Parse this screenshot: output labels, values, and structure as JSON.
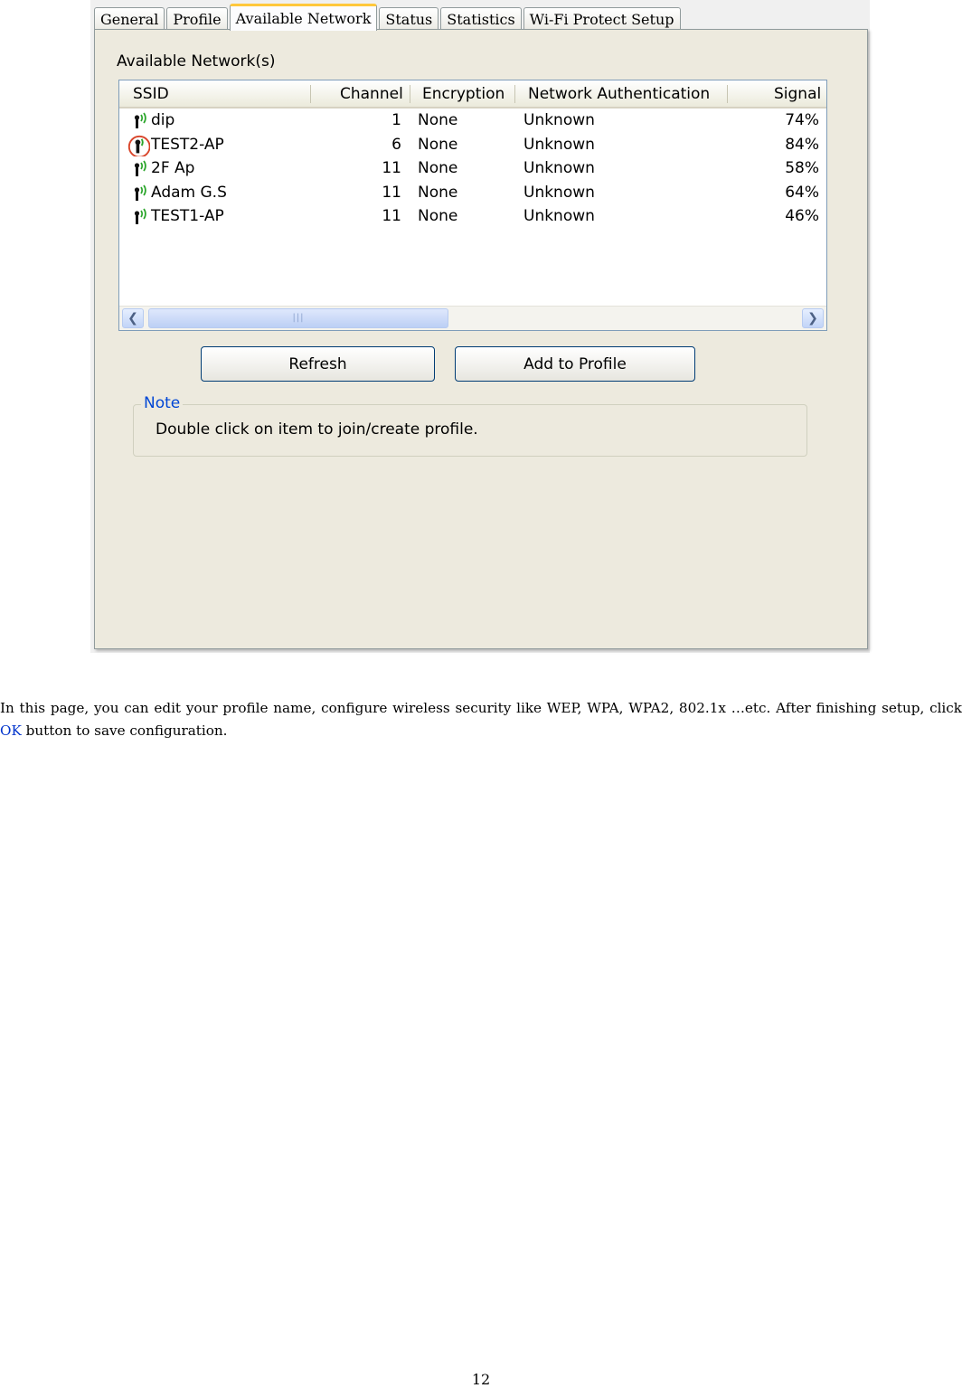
{
  "dialog": {
    "tabs": [
      {
        "label": "General",
        "active": false
      },
      {
        "label": "Profile",
        "active": false
      },
      {
        "label": "Available Network",
        "active": true
      },
      {
        "label": "Status",
        "active": false
      },
      {
        "label": "Statistics",
        "active": false
      },
      {
        "label": "Wi-Fi Protect Setup",
        "active": false
      }
    ],
    "section_title": "Available Network(s)",
    "table": {
      "columns": [
        "SSID",
        "Channel",
        "Encryption",
        "Network Authentication",
        "Signal"
      ],
      "rows": [
        {
          "ssid": "dip",
          "channel": "1",
          "encryption": "None",
          "auth": "Unknown",
          "signal": "74%",
          "connected": false
        },
        {
          "ssid": "TEST2-AP",
          "channel": "6",
          "encryption": "None",
          "auth": "Unknown",
          "signal": "84%",
          "connected": true
        },
        {
          "ssid": "2F Ap",
          "channel": "11",
          "encryption": "None",
          "auth": "Unknown",
          "signal": "58%",
          "connected": false
        },
        {
          "ssid": "Adam G.S",
          "channel": "11",
          "encryption": "None",
          "auth": "Unknown",
          "signal": "64%",
          "connected": false
        },
        {
          "ssid": "TEST1-AP",
          "channel": "11",
          "encryption": "None",
          "auth": "Unknown",
          "signal": "46%",
          "connected": false
        }
      ]
    },
    "buttons": {
      "refresh": "Refresh",
      "add_to_profile": "Add to Profile"
    },
    "note": {
      "label": "Note",
      "text": "Double click on item to join/create profile."
    }
  },
  "document": {
    "paragraph_before": "In this page, you can edit your profile name, configure wireless security like WEP, WPA, WPA2, 802.1x …etc. After finishing setup, click",
    "ok_label": "OK",
    "paragraph_after": "button to save configuration.",
    "page_number": "12"
  },
  "colors": {
    "accent_tab": "#ffc83c",
    "note_label": "#0046d5",
    "ok_link": "#0033cc",
    "connected_ring": "#d9452a"
  }
}
